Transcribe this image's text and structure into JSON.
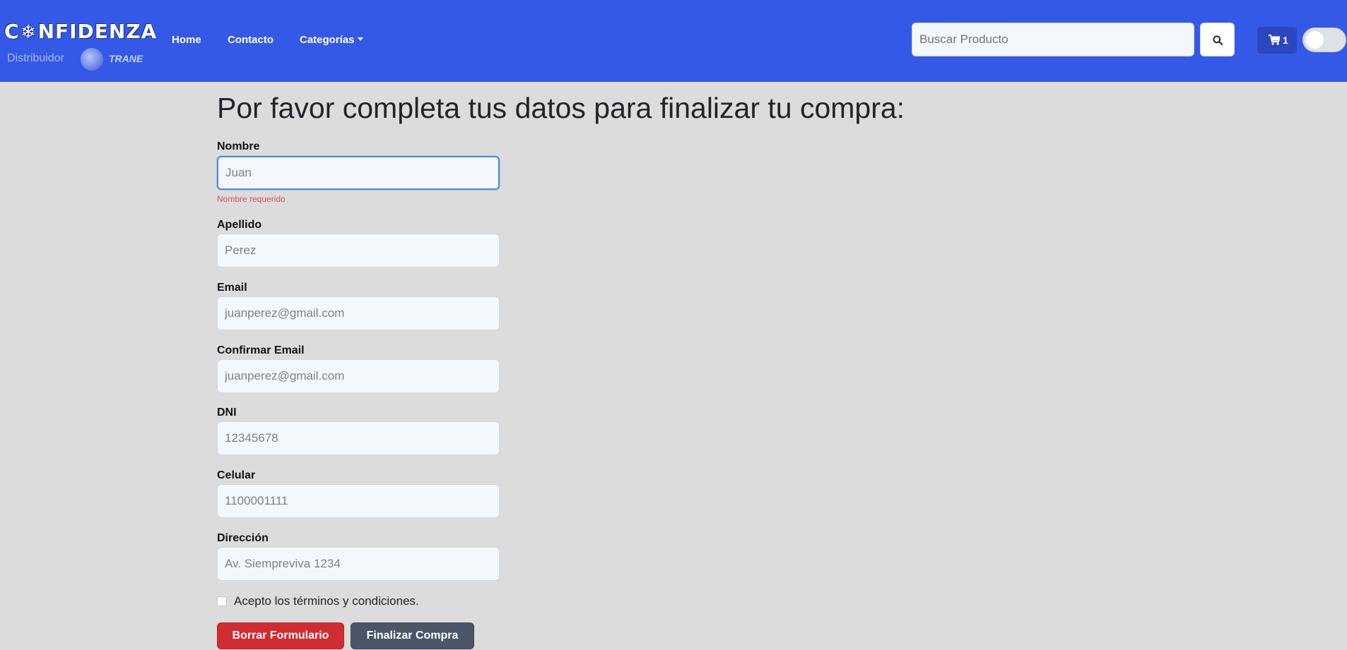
{
  "brand": {
    "name_part1": "C",
    "name_part2": "NFIDENZA",
    "subtitle": "Distribuidor",
    "partner": "TRANE"
  },
  "nav": {
    "home": "Home",
    "contacto": "Contacto",
    "categorias": "Categorías"
  },
  "search": {
    "placeholder": "Buscar Producto",
    "button_icon": "search-icon"
  },
  "cart": {
    "icon": "cart-icon",
    "count": "1"
  },
  "theme_toggle": {
    "on": false
  },
  "form": {
    "title": "Por favor completa tus datos para finalizar tu compra:",
    "fields": [
      {
        "label": "Nombre",
        "placeholder": "Juan",
        "error": "Nombre requerido"
      },
      {
        "label": "Apellido",
        "placeholder": "Perez"
      },
      {
        "label": "Email",
        "placeholder": "juanperez@gmail.com"
      },
      {
        "label": "Confirmar Email",
        "placeholder": "juanperez@gmail.com"
      },
      {
        "label": "DNI",
        "placeholder": "12345678"
      },
      {
        "label": "Celular",
        "placeholder": "1100001111"
      },
      {
        "label": "Dirección",
        "placeholder": "Av. Siempreviva 1234"
      }
    ],
    "terms_label": "Acepto los términos y condiciones.",
    "clear_button": "Borrar Formulario",
    "submit_button": "Finalizar Compra"
  },
  "colors": {
    "navbar": "#3459e6",
    "page_bg": "#dcdcdc",
    "danger": "#d02c32",
    "secondary": "#4b5568",
    "error": "#d9534f"
  }
}
